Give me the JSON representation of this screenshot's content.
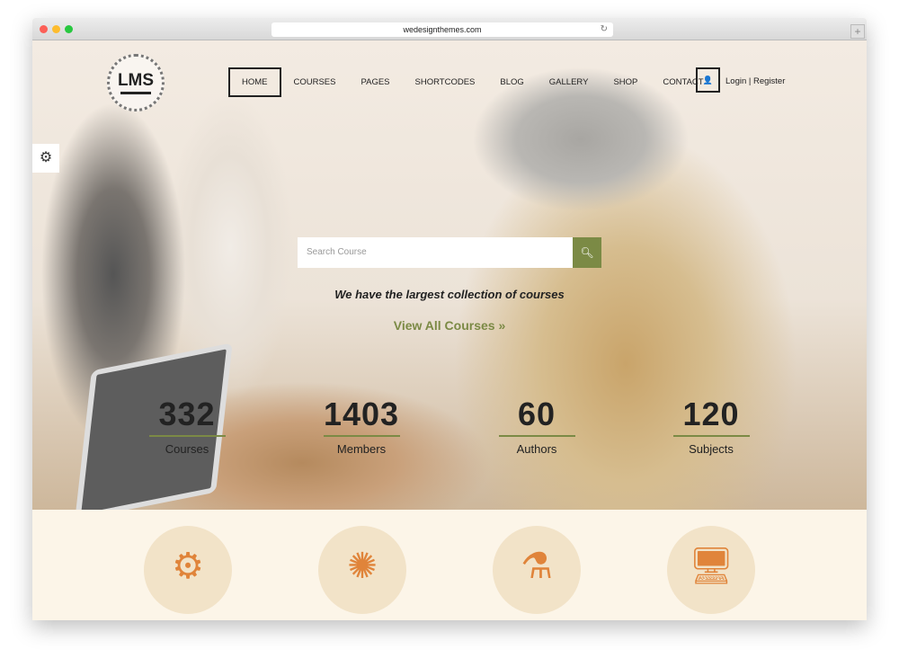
{
  "browser": {
    "url": "wedesignthemes.com"
  },
  "logo": {
    "text": "LMS"
  },
  "nav": {
    "items": [
      "HOME",
      "COURSES",
      "PAGES",
      "SHORTCODES",
      "BLOG",
      "GALLERY",
      "SHOP",
      "CONTACT"
    ],
    "login": "Login",
    "separator": "|",
    "register": "Register"
  },
  "search": {
    "placeholder": "Search Course"
  },
  "hero": {
    "tagline": "We have the largest collection of courses",
    "cta": "View All Courses",
    "cta_icon": "»"
  },
  "stats": [
    {
      "value": "332",
      "label": "Courses"
    },
    {
      "value": "1403",
      "label": "Members"
    },
    {
      "value": "60",
      "label": "Authors"
    },
    {
      "value": "120",
      "label": "Subjects"
    }
  ],
  "features": [
    {
      "icon": "head-gears-icon"
    },
    {
      "icon": "network-person-icon"
    },
    {
      "icon": "flask-icon"
    },
    {
      "icon": "monitor-brush-icon"
    }
  ],
  "colors": {
    "accent": "#7b8a45",
    "feature_icon": "#e0843a",
    "section_bg": "#fcf5e8"
  }
}
